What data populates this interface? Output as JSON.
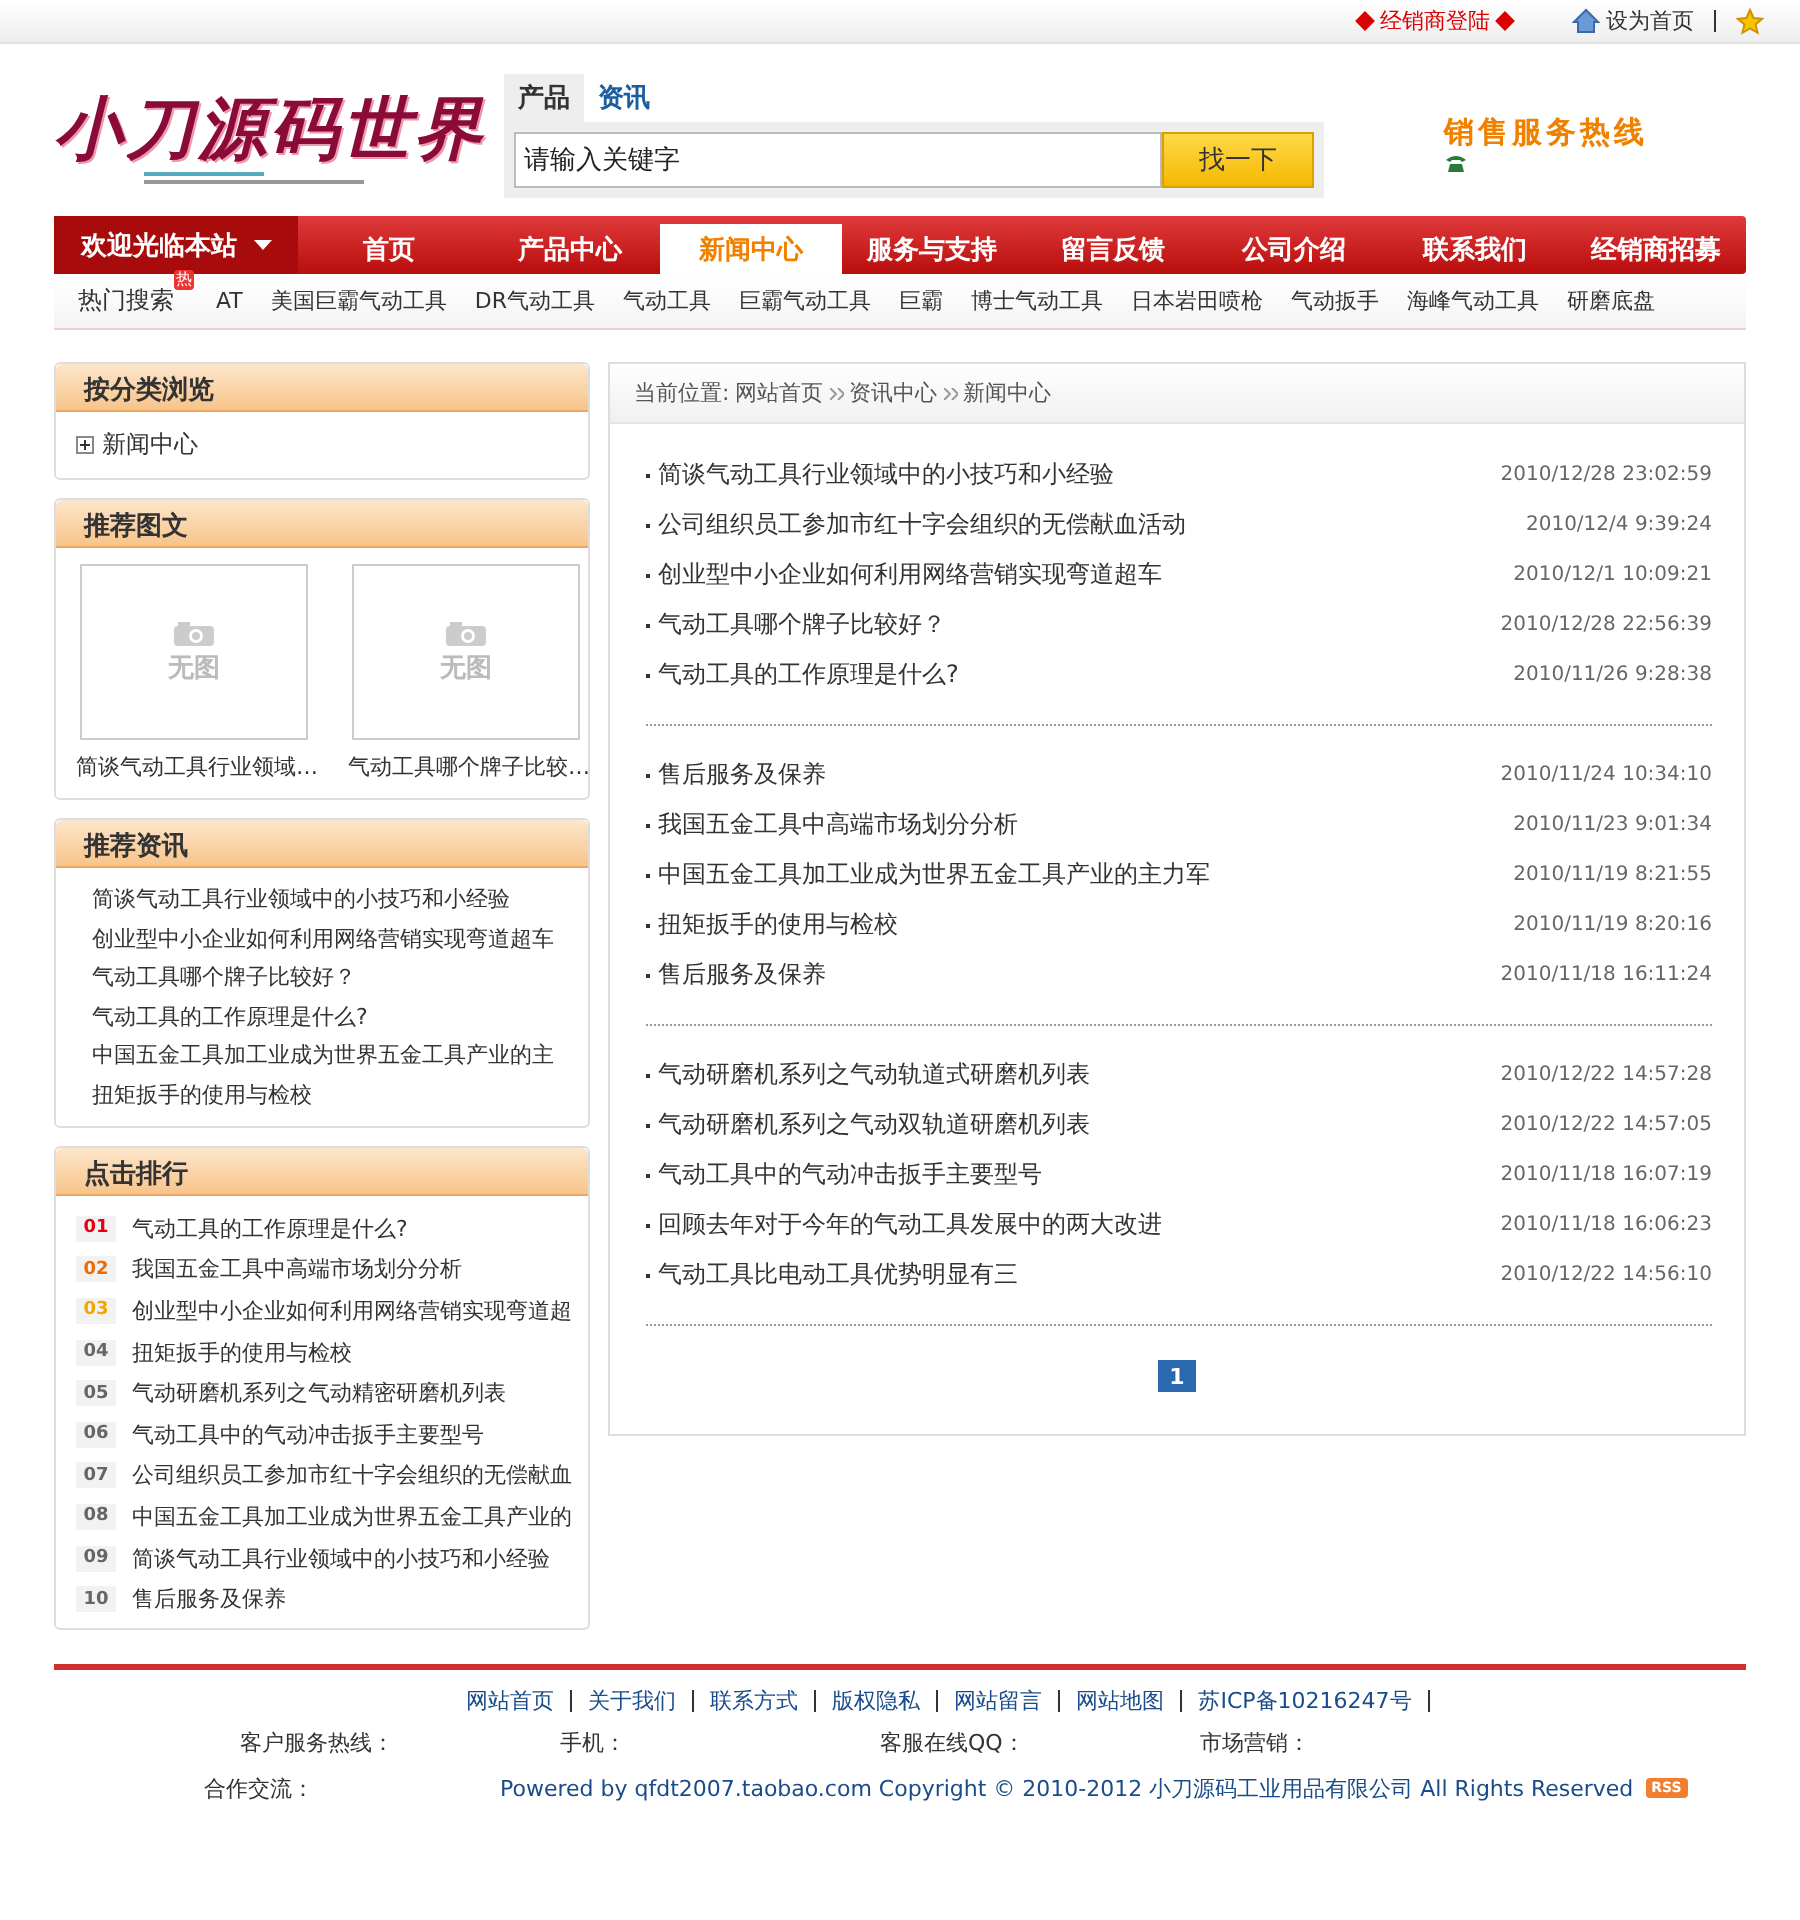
{
  "top_bar": {
    "dealer_login": "经销商登陆",
    "set_homepage": "设为首页"
  },
  "header": {
    "logo": "小刀源码世界",
    "search": {
      "tabs": [
        {
          "label": "产品",
          "selected": true
        },
        {
          "label": "资讯",
          "selected": false
        }
      ],
      "placeholder": "请输入关键字",
      "button": "找一下"
    },
    "hotline": "销售服务热线"
  },
  "nav": {
    "welcome": "欢迎光临本站",
    "items": [
      {
        "label": "首页",
        "selected": false
      },
      {
        "label": "产品中心",
        "selected": false
      },
      {
        "label": "新闻中心",
        "selected": true
      },
      {
        "label": "服务与支持",
        "selected": false
      },
      {
        "label": "留言反馈",
        "selected": false
      },
      {
        "label": "公司介绍",
        "selected": false
      },
      {
        "label": "联系我们",
        "selected": false
      },
      {
        "label": "经销商招募",
        "selected": false
      }
    ]
  },
  "hot_search": {
    "label": "热门搜索",
    "badge": "热",
    "terms": [
      "AT",
      "美国巨霸气动工具",
      "DR气动工具",
      "气动工具",
      "巨霸气动工具",
      "巨霸",
      "博士气动工具",
      "日本岩田喷枪",
      "气动扳手",
      "海峰气动工具",
      "研磨底盘"
    ]
  },
  "sidebar": {
    "category": {
      "title": "按分类浏览",
      "items": [
        "新闻中心"
      ]
    },
    "picks": {
      "title": "推荐图文",
      "items": [
        {
          "caption": "简谈气动工具行业领域…",
          "placeholder": "无图"
        },
        {
          "caption": "气动工具哪个牌子比较…",
          "placeholder": "无图"
        }
      ]
    },
    "news": {
      "title": "推荐资讯",
      "items": [
        "简谈气动工具行业领域中的小技巧和小经验",
        "创业型中小企业如何利用网络营销实现弯道超车",
        "气动工具哪个牌子比较好？",
        "气动工具的工作原理是什么?",
        "中国五金工具加工业成为世界五金工具产业的主",
        "扭矩扳手的使用与检校"
      ]
    },
    "ranking": {
      "title": "点击排行",
      "items": [
        {
          "rank": "01",
          "title": "气动工具的工作原理是什么?",
          "color": "#e60012"
        },
        {
          "rank": "02",
          "title": "我国五金工具中高端市场划分分析",
          "color": "#f06a00"
        },
        {
          "rank": "03",
          "title": "创业型中小企业如何利用网络营销实现弯道超",
          "color": "#f0a800"
        },
        {
          "rank": "04",
          "title": "扭矩扳手的使用与检校",
          "color": "#666666"
        },
        {
          "rank": "05",
          "title": "气动研磨机系列之气动精密研磨机列表",
          "color": "#666666"
        },
        {
          "rank": "06",
          "title": "气动工具中的气动冲击扳手主要型号",
          "color": "#666666"
        },
        {
          "rank": "07",
          "title": "公司组织员工参加市红十字会组织的无偿献血",
          "color": "#666666"
        },
        {
          "rank": "08",
          "title": "中国五金工具加工业成为世界五金工具产业的",
          "color": "#666666"
        },
        {
          "rank": "09",
          "title": "简谈气动工具行业领域中的小技巧和小经验",
          "color": "#666666"
        },
        {
          "rank": "10",
          "title": "售后服务及保养",
          "color": "#666666"
        }
      ]
    }
  },
  "main": {
    "breadcrumb": {
      "prefix": "当前位置:",
      "links": [
        "网站首页",
        "资讯中心",
        "新闻中心"
      ]
    },
    "groups": [
      [
        {
          "title": "简谈气动工具行业领域中的小技巧和小经验",
          "date": "2010/12/28 23:02:59"
        },
        {
          "title": "公司组织员工参加市红十字会组织的无偿献血活动",
          "date": "2010/12/4 9:39:24"
        },
        {
          "title": "创业型中小企业如何利用网络营销实现弯道超车",
          "date": "2010/12/1 10:09:21"
        },
        {
          "title": "气动工具哪个牌子比较好？",
          "date": "2010/12/28 22:56:39"
        },
        {
          "title": "气动工具的工作原理是什么?",
          "date": "2010/11/26 9:28:38"
        }
      ],
      [
        {
          "title": "售后服务及保养",
          "date": "2010/11/24 10:34:10"
        },
        {
          "title": "我国五金工具中高端市场划分分析",
          "date": "2010/11/23 9:01:34"
        },
        {
          "title": "中国五金工具加工业成为世界五金工具产业的主力军",
          "date": "2010/11/19 8:21:55"
        },
        {
          "title": "扭矩扳手的使用与检校",
          "date": "2010/11/19 8:20:16"
        },
        {
          "title": "售后服务及保养",
          "date": "2010/11/18 16:11:24"
        }
      ],
      [
        {
          "title": "气动研磨机系列之气动轨道式研磨机列表",
          "date": "2010/12/22 14:57:28"
        },
        {
          "title": "气动研磨机系列之气动双轨道研磨机列表",
          "date": "2010/12/22 14:57:05"
        },
        {
          "title": "气动工具中的气动冲击扳手主要型号",
          "date": "2010/11/18 16:07:19"
        },
        {
          "title": "回顾去年对于今年的气动工具发展中的两大改进",
          "date": "2010/11/18 16:06:23"
        },
        {
          "title": "气动工具比电动工具优势明显有三",
          "date": "2010/12/22 14:56:10"
        }
      ]
    ],
    "pagination": [
      {
        "label": "1",
        "selected": true
      }
    ]
  },
  "footer": {
    "links": [
      "网站首页",
      "关于我们",
      "联系方式",
      "版权隐私",
      "网站留言",
      "网站地图",
      "苏ICP备10216247号"
    ],
    "contacts": [
      "客户服务热线：",
      "手机：",
      "客服在线QQ：",
      "市场营销："
    ],
    "partner": "合作交流：",
    "copyright": "Powered by qfdt2007.taobao.com Copyright © 2010-2012 小刀源码工业用品有限公司 All Rights Reserved",
    "rss": "RSS"
  }
}
